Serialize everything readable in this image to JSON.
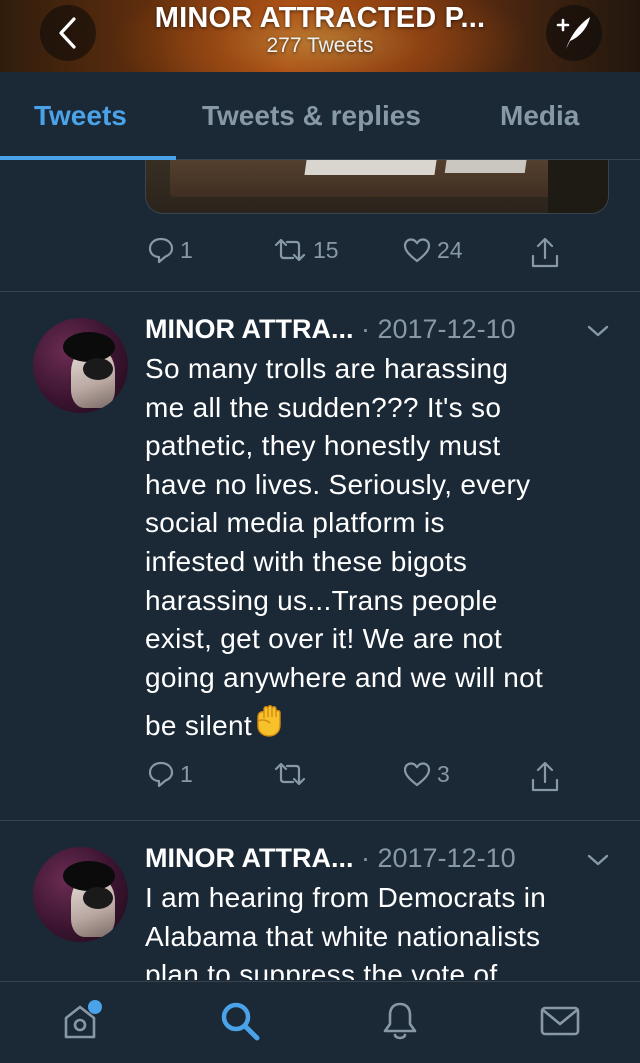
{
  "header": {
    "title": "MINOR ATTRACTED P...",
    "tweet_count": "277 Tweets",
    "back_icon": "chevron-left-icon",
    "compose_icon": "compose-tweet-icon"
  },
  "tabs": [
    {
      "label": "Tweets",
      "active": true
    },
    {
      "label": "Tweets & replies",
      "active": false
    },
    {
      "label": "Media",
      "active": false
    }
  ],
  "colors": {
    "background": "#1b2836",
    "accent": "#4aa3e8",
    "muted": "#8899a6",
    "divider": "#38444d"
  },
  "feed": {
    "previous_tweet": {
      "actions": {
        "replies": "1",
        "retweets": "15",
        "likes": "24"
      }
    },
    "tweets": [
      {
        "name": "MINOR ATTRA...",
        "date": "· 2017-12-10",
        "lines": [
          "So many trolls are harassing",
          "me all the sudden??? It's so",
          "pathetic, they honestly must",
          "have no lives. Seriously, every",
          "social media platform is",
          "infested with these bigots",
          "harassing us...Trans people",
          "exist, get over it! We are not",
          "going anywhere and we will not",
          "be silent"
        ],
        "emoji": "raised-fist-icon",
        "actions": {
          "replies": "1",
          "retweets": "",
          "likes": "3"
        }
      },
      {
        "name": "MINOR ATTRA...",
        "date": "· 2017-12-10",
        "lines": [
          "I am hearing from Democrats in",
          "Alabama that white nationalists",
          "plan to suppress the vote of"
        ]
      }
    ]
  },
  "bottom_nav": [
    {
      "icon": "home-icon",
      "has_notification_dot": true
    },
    {
      "icon": "search-icon",
      "active": true
    },
    {
      "icon": "notifications-bell-icon"
    },
    {
      "icon": "messages-envelope-icon"
    }
  ]
}
